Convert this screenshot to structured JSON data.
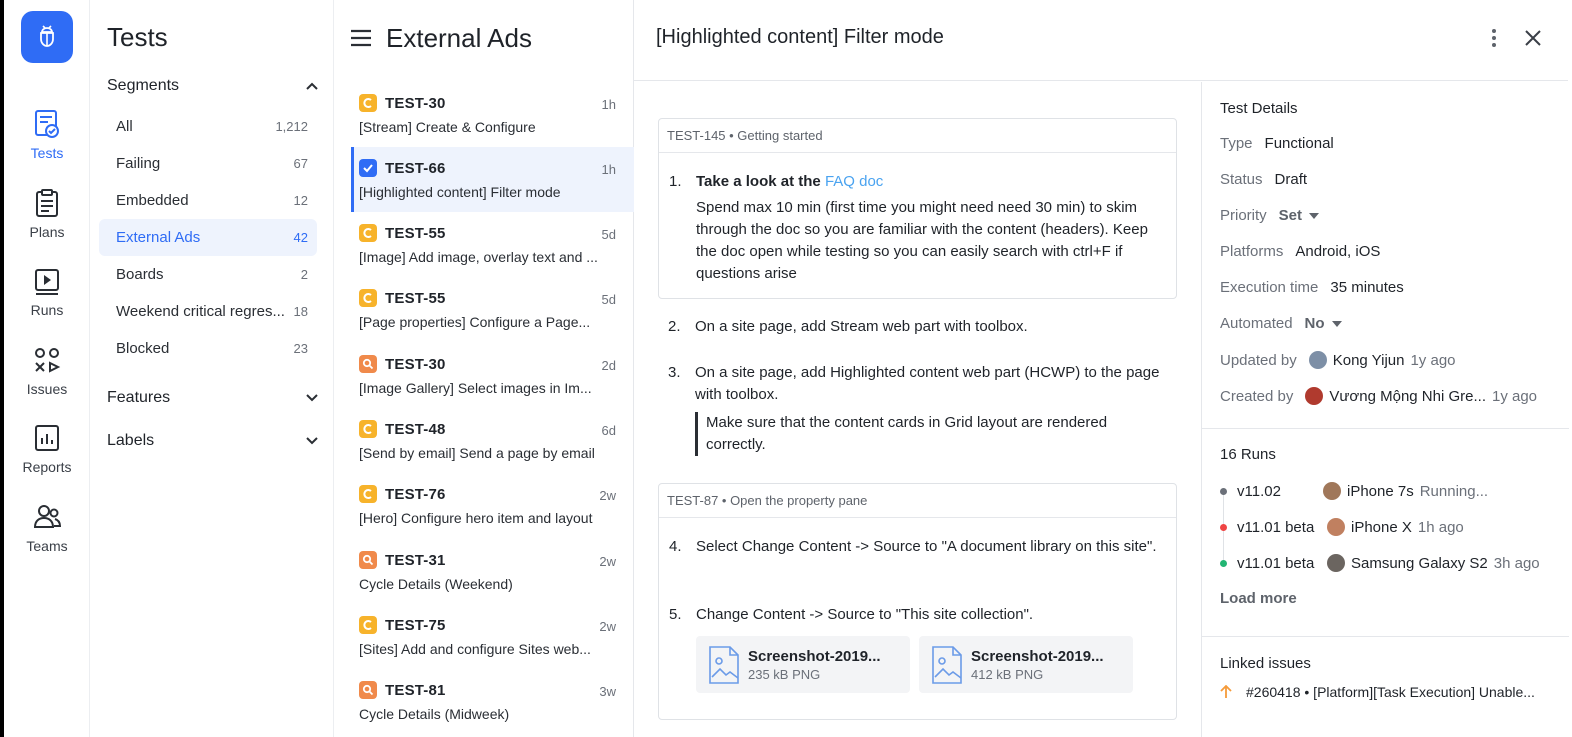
{
  "rail": {
    "items": [
      {
        "label": "Tests",
        "icon": "tests-icon",
        "active": true
      },
      {
        "label": "Plans",
        "icon": "clipboard-icon"
      },
      {
        "label": "Runs",
        "icon": "play-icon"
      },
      {
        "label": "Issues",
        "icon": "issues-icon"
      },
      {
        "label": "Reports",
        "icon": "chart-icon"
      },
      {
        "label": "Teams",
        "icon": "team-icon"
      }
    ]
  },
  "segments": {
    "title": "Tests",
    "group_segments": "Segments",
    "items": [
      {
        "name": "All",
        "count": "1,212"
      },
      {
        "name": "Failing",
        "count": "67"
      },
      {
        "name": "Embedded",
        "count": "12"
      },
      {
        "name": "External Ads",
        "count": "42"
      },
      {
        "name": "Boards",
        "count": "2"
      },
      {
        "name": "Weekend critical regres...",
        "count": "18"
      },
      {
        "name": "Blocked",
        "count": "23"
      }
    ],
    "group_features": "Features",
    "group_labels": "Labels"
  },
  "list": {
    "title": "External Ads",
    "rows": [
      {
        "id": "TEST-30",
        "age": "1h",
        "desc": "[Stream] Create & Configure",
        "badge": "c"
      },
      {
        "id": "TEST-66",
        "age": "1h",
        "desc": "[Highlighted content] Filter mode",
        "badge": "check"
      },
      {
        "id": "TEST-55",
        "age": "5d",
        "desc": "[Image] Add image, overlay text and ...",
        "badge": "c"
      },
      {
        "id": "TEST-55",
        "age": "5d",
        "desc": "[Page properties] Configure a Page...",
        "badge": "c"
      },
      {
        "id": "TEST-30",
        "age": "2d",
        "desc": "[Image Gallery] Select images in Im...",
        "badge": "q"
      },
      {
        "id": "TEST-48",
        "age": "6d",
        "desc": "[Send by email] Send a page by email",
        "badge": "c"
      },
      {
        "id": "TEST-76",
        "age": "2w",
        "desc": "[Hero] Configure hero item and layout",
        "badge": "c"
      },
      {
        "id": "TEST-31",
        "age": "2w",
        "desc": "Cycle Details (Weekend)",
        "badge": "q"
      },
      {
        "id": "TEST-75",
        "age": "2w",
        "desc": "[Sites] Add and configure Sites web...",
        "badge": "c"
      },
      {
        "id": "TEST-81",
        "age": "3w",
        "desc": "Cycle Details (Midweek)",
        "badge": "q"
      }
    ]
  },
  "detail": {
    "title": "[Highlighted content] Filter mode",
    "card1_header": "TEST-145 • Getting started",
    "step1_num": "1.",
    "step1_lead": "Take a look at the ",
    "step1_link": "FAQ doc",
    "step1_text": "Spend max 10 min (first time you might need need 30 min) to skim through the doc so you are familiar with the content (headers). Keep the doc open while testing so you can easily search with ctrl+F if questions arise",
    "step2_num": "2.",
    "step2_text": "On a site page, add Stream web part with toolbox.",
    "step3_num": "3.",
    "step3_text": "On a site page, add Highlighted content web part (HCWP) to the page with toolbox.",
    "step3_note": "Make sure that the content cards in Grid layout are rendered correctly.",
    "card2_header": "TEST-87 • Open the property pane",
    "step4_num": "4.",
    "step4_text": "Select Change Content -> Source to \"A document library on this site\".",
    "step5_num": "5.",
    "step5_text": "Change Content -> Source to \"This site collection\".",
    "files": [
      {
        "name": "Screenshot-2019...",
        "meta": "235 kB PNG"
      },
      {
        "name": "Screenshot-2019...",
        "meta": "412 kB PNG"
      }
    ]
  },
  "details_panel": {
    "title": "Test Details",
    "type_label": "Type",
    "type_value": "Functional",
    "status_label": "Status",
    "status_value": "Draft",
    "priority_label": "Priority",
    "priority_value": "Set",
    "platforms_label": "Platforms",
    "platforms_value": "Android, iOS",
    "exec_label": "Execution time",
    "exec_value": "35 minutes",
    "automated_label": "Automated",
    "automated_value": "No",
    "updated_label": "Updated by",
    "updated_name": "Kong Yijun",
    "updated_ago": "1y ago",
    "created_label": "Created by",
    "created_name": "Vương Mộng Nhi Gre...",
    "created_ago": "1y ago",
    "runs_title": "16 Runs",
    "runs": [
      {
        "version": "v11.02",
        "device": "iPhone 7s",
        "status": "Running...",
        "color": "#6b7079"
      },
      {
        "version": "v11.01 beta",
        "device": "iPhone X",
        "status": "1h ago",
        "color": "#ef4444"
      },
      {
        "version": "v11.01 beta",
        "device": "Samsung Galaxy S2",
        "status": "3h ago",
        "color": "#22b573"
      }
    ],
    "load_more": "Load more",
    "linked_title": "Linked issues",
    "linked_issue": "#260418 • [Platform][Task Execution] Unable..."
  },
  "colors": {
    "accent": "#2f6cf5",
    "badge_orange": "#f7b32b",
    "badge_red": "#f08a4b",
    "link": "#4aa3f0"
  }
}
